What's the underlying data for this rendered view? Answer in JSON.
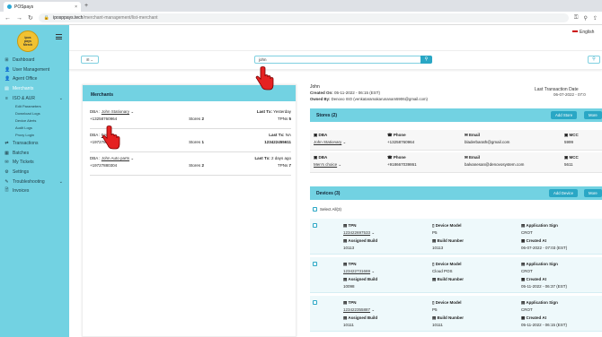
{
  "browser": {
    "tab_title": "POSpays",
    "url_host": "iposppays.tech",
    "url_path": "/merchant-management/list-merchant"
  },
  "logo": {
    "line1": "ipos",
    "line2": "pays",
    "line3": "Merch"
  },
  "sidebar": {
    "items": [
      {
        "icon": "⊞",
        "label": "Dashboard"
      },
      {
        "icon": "👤",
        "label": "User Management"
      },
      {
        "icon": "👤",
        "label": "Agent Office"
      },
      {
        "icon": "▤",
        "label": "Merchants"
      },
      {
        "icon": "≡",
        "label": "ISO & AUR"
      }
    ],
    "subitems": [
      "Edit Parameters",
      "Download Logs",
      "Device Alerts",
      "Audit Logs",
      "Proxy Login"
    ],
    "items2": [
      {
        "icon": "⇄",
        "label": "Transactions"
      },
      {
        "icon": "▦",
        "label": "Batches"
      },
      {
        "icon": "✉",
        "label": "My Tickets"
      },
      {
        "icon": "⚙",
        "label": "Settings"
      },
      {
        "icon": "✎",
        "label": "Troubleshooting"
      },
      {
        "icon": "🗎",
        "label": "Invoices"
      }
    ]
  },
  "header": {
    "language": "English"
  },
  "filters": {
    "view": "⊞ ⌄",
    "search_value": "john",
    "search_icon": "⚲",
    "filter_icon": "⚲"
  },
  "merchants_panel": {
    "title": "Merchants",
    "cards": [
      {
        "dba_label": "DBA :",
        "dba": "John Stationary",
        "last_label": "Last Tx:",
        "last": "Yesterday",
        "phone": "+13258760964",
        "stores_label": "Stores",
        "stores": "2",
        "tpns_label": "TPNs",
        "tpns": "5"
      },
      {
        "dba_label": "DBA :",
        "dba": "Feri...",
        "last_label": "Last Tx:",
        "last": "NA",
        "phone": "+19727880304",
        "stores_label": "Stores",
        "stores": "1",
        "tpns_label": "",
        "tpns": "123422455611"
      },
      {
        "dba_label": "DBA :",
        "dba": "John Auto parts",
        "last_label": "Last Tx:",
        "last": "2 days ago",
        "phone": "+19727880304",
        "stores_label": "Stores",
        "stores": "2",
        "tpns_label": "TPNs",
        "tpns": "7"
      }
    ]
  },
  "detail": {
    "name": "John",
    "created_label": "Created On:",
    "created": "05-11-2022 - 06:15 (EST)",
    "owned_label": "Owned By:",
    "owned": "Denovo ISO (venkataramakarunanam5906@gmail.com)",
    "last_tx_label": "Last Transaction Date",
    "last_tx": "06-07-2022 - 07:0",
    "stores": {
      "title": "Stores (2)",
      "add_label": "Add Store",
      "more_label": "More",
      "rows": [
        {
          "dba": "John Stationary",
          "phone": "+13258760964",
          "email": "bladerbarath@gmail.com",
          "mcc": "5999"
        },
        {
          "dba": "Men's choice",
          "phone": "+918667039861",
          "email": "balvanesan@denovosystem.com",
          "mcc": "5611"
        }
      ],
      "labels": {
        "dba": "DBA",
        "phone": "Phone",
        "email": "Email",
        "mcc": "MCC"
      }
    },
    "devices": {
      "title": "Devices (3)",
      "add_label": "Add Device",
      "more_label": "More",
      "select_all": "Select All(3)",
      "labels": {
        "tpn": "TPN",
        "model": "Device Model",
        "sign": "Application Sign",
        "assigned": "Assigned Build",
        "build": "Build Number",
        "created": "Created At"
      },
      "rows": [
        {
          "tpn": "123422697533",
          "model": "P5",
          "sign": "CROT",
          "assigned": "10113",
          "build": "10113",
          "created": "06-07-2022 - 07:03 (EST)"
        },
        {
          "tpn": "123422731669",
          "model": "Cloud POS",
          "sign": "CROT",
          "assigned": "10098",
          "build": "",
          "created": "05-11-2022 - 06:37 (EST)"
        },
        {
          "tpn": "123422355887",
          "model": "P5",
          "sign": "CROT",
          "assigned": "10111",
          "build": "10111",
          "created": "05-11-2022 - 06:15 (EST)"
        }
      ]
    }
  },
  "colors": {
    "accent": "#72d2e2",
    "button": "#2aa7c5",
    "pointer": "#e52222"
  }
}
